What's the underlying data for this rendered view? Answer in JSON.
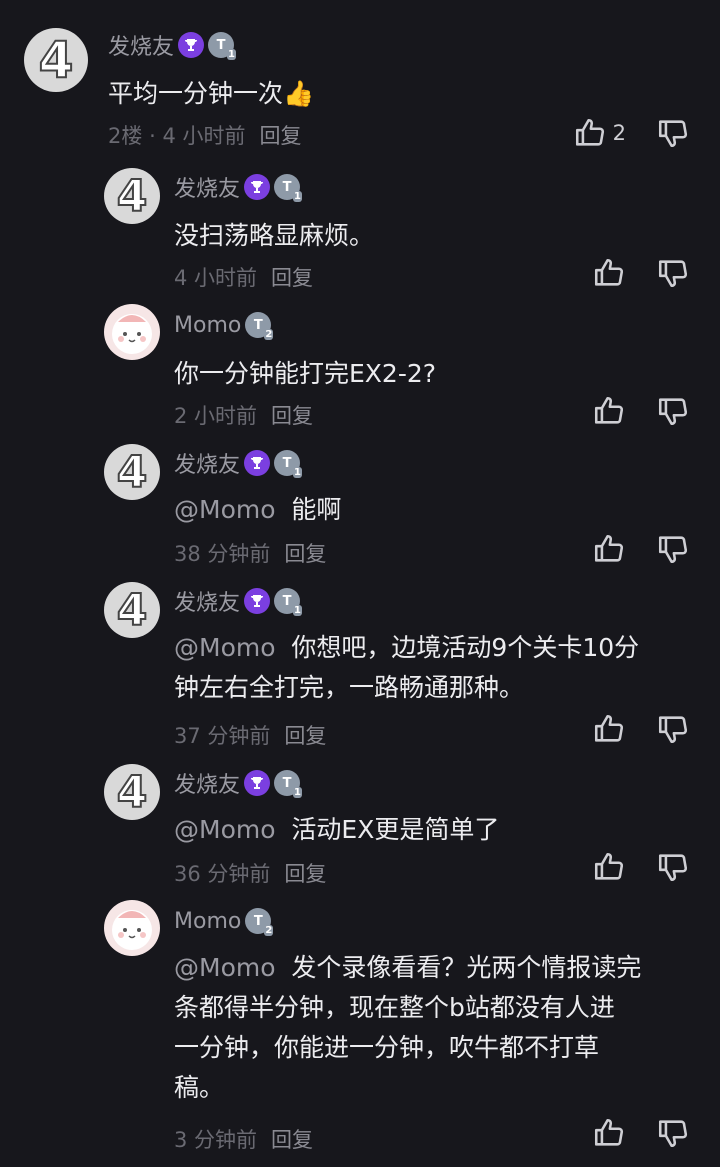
{
  "colors": {
    "background": "#17171c",
    "username": "#9a9aa2",
    "meta": "#6a6a72",
    "trophy_badge": "#7b3fe0",
    "level_badge": "#8e9aa8"
  },
  "comments": [
    {
      "user": "发烧友",
      "avatar": "4",
      "badges": {
        "trophy": true,
        "level": "1"
      },
      "mention": "",
      "text": "平均一分钟一次👍",
      "floor": "2楼",
      "dot": "·",
      "time": "4 小时前",
      "reply": "回复",
      "likes": "2"
    },
    {
      "user": "发烧友",
      "avatar": "4",
      "badges": {
        "trophy": true,
        "level": "1"
      },
      "mention": "",
      "text": "没扫荡略显麻烦。",
      "time": "4 小时前",
      "reply": "回复",
      "likes": ""
    },
    {
      "user": "Momo",
      "avatar": "momo",
      "badges": {
        "trophy": false,
        "level": "2"
      },
      "mention": "",
      "text": "你一分钟能打完EX2-2?",
      "time": "2 小时前",
      "reply": "回复",
      "likes": ""
    },
    {
      "user": "发烧友",
      "avatar": "4",
      "badges": {
        "trophy": true,
        "level": "1"
      },
      "mention": "@Momo",
      "text": "能啊",
      "time": "38 分钟前",
      "reply": "回复",
      "likes": ""
    },
    {
      "user": "发烧友",
      "avatar": "4",
      "badges": {
        "trophy": true,
        "level": "1"
      },
      "mention": "@Momo",
      "text": "你想吧，边境活动9个关卡10分",
      "text2": "钟左右全打完，一路畅通那种。",
      "time": "37 分钟前",
      "reply": "回复",
      "likes": ""
    },
    {
      "user": "发烧友",
      "avatar": "4",
      "badges": {
        "trophy": true,
        "level": "1"
      },
      "mention": "@Momo",
      "text": "活动EX更是简单了",
      "time": "36 分钟前",
      "reply": "回复",
      "likes": ""
    },
    {
      "user": "Momo",
      "avatar": "momo",
      "badges": {
        "trophy": false,
        "level": "2"
      },
      "mention": "@Momo",
      "text": "发个录像看看？光两个情报读完",
      "text2": "条都得半分钟，现在整个b站都没有人进",
      "text3": "一分钟，你能进一分钟，吹牛都不打草",
      "text4": "稿。",
      "time": "3 分钟前",
      "reply": "回复",
      "likes": ""
    }
  ]
}
